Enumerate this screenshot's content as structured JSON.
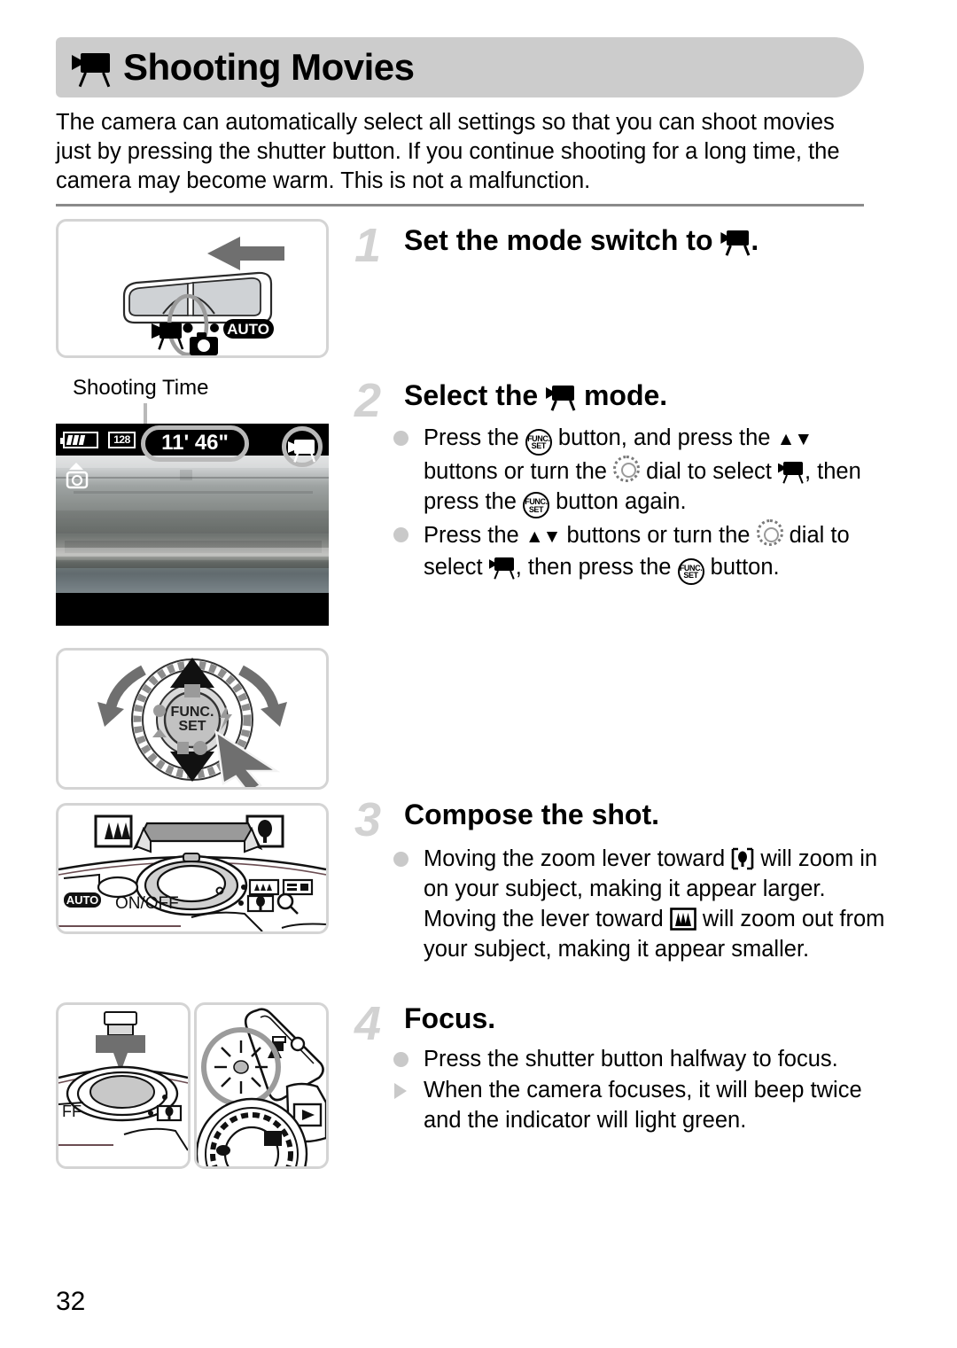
{
  "header": {
    "icon": "movie-camera-icon",
    "title": "Shooting Movies"
  },
  "intro": "The camera can automatically select all settings so that you can shoot movies just by pressing the shutter button. If you continue shooting for a long time, the camera may become warm. This is not a malfunction.",
  "steps": [
    {
      "number": "1",
      "heading_before": "Set the mode switch to ",
      "heading_icon": "movie-camera-icon",
      "heading_after": "."
    },
    {
      "number": "2",
      "heading_before": "Select the ",
      "heading_icon": "movie-camera-icon",
      "heading_after": " mode.",
      "bullets": [
        {
          "marker": "dot",
          "parts": [
            {
              "t": "text",
              "v": "Press the "
            },
            {
              "t": "icon",
              "v": "func-set-button-icon"
            },
            {
              "t": "text",
              "v": " button, and press the "
            },
            {
              "t": "icon",
              "v": "up-down-arrows-icon"
            },
            {
              "t": "text",
              "v": " buttons or turn the "
            },
            {
              "t": "icon",
              "v": "control-dial-icon"
            },
            {
              "t": "text",
              "v": " dial to select "
            },
            {
              "t": "icon",
              "v": "movie-camera-icon"
            },
            {
              "t": "text",
              "v": ", then press the "
            },
            {
              "t": "icon",
              "v": "func-set-button-icon"
            },
            {
              "t": "text",
              "v": " button again."
            }
          ]
        },
        {
          "marker": "dot",
          "parts": [
            {
              "t": "text",
              "v": "Press the "
            },
            {
              "t": "icon",
              "v": "up-down-arrows-icon"
            },
            {
              "t": "text",
              "v": " buttons or turn the "
            },
            {
              "t": "icon",
              "v": "control-dial-icon"
            },
            {
              "t": "text",
              "v": " dial to select "
            },
            {
              "t": "icon",
              "v": "movie-camera-icon"
            },
            {
              "t": "text",
              "v": ", then press the "
            },
            {
              "t": "icon",
              "v": "func-set-button-icon"
            },
            {
              "t": "text",
              "v": " button."
            }
          ]
        }
      ]
    },
    {
      "number": "3",
      "heading_before": "Compose the shot.",
      "heading_icon": "",
      "heading_after": "",
      "bullets": [
        {
          "marker": "dot",
          "parts": [
            {
              "t": "text",
              "v": "Moving the zoom lever toward "
            },
            {
              "t": "icon",
              "v": "telephoto-icon"
            },
            {
              "t": "text",
              "v": " will zoom in on your subject, making it appear larger. Moving the lever toward "
            },
            {
              "t": "icon",
              "v": "wide-angle-icon"
            },
            {
              "t": "text",
              "v": " will zoom out from your subject, making it appear smaller."
            }
          ]
        }
      ]
    },
    {
      "number": "4",
      "heading_before": "Focus.",
      "heading_icon": "",
      "heading_after": "",
      "bullets": [
        {
          "marker": "dot",
          "parts": [
            {
              "t": "text",
              "v": "Press the shutter button halfway to focus."
            }
          ]
        },
        {
          "marker": "triangle",
          "parts": [
            {
              "t": "text",
              "v": "When the camera focuses, it will beep twice and the indicator will light green."
            }
          ]
        }
      ]
    }
  ],
  "lcd": {
    "callout_label": "Shooting Time",
    "shooting_time": "11' 46\"",
    "card_label": "128",
    "battery_icon": "battery-icon",
    "stabilizer_icon": "image-stabilizer-icon",
    "mode_icon": "movie-mode-icon"
  },
  "illustrations": {
    "mode_switch": {
      "name": "mode-switch-illustration",
      "auto_label": "AUTO",
      "movie_icon": "movie-camera-icon",
      "photo_icon": "still-camera-icon",
      "arrow": "left-arrow"
    },
    "control_dial": {
      "name": "control-dial-illustration",
      "button_label_top": "FUNC.",
      "button_label_bottom": "SET"
    },
    "zoom_lever": {
      "name": "zoom-lever-illustration",
      "wide_icon": "wide-angle-icon",
      "tele_icon": "telephoto-icon",
      "power_label": "ON/OFF",
      "auto_label": "AUTO",
      "search_icon": "magnifier-icon"
    },
    "shutter": {
      "name": "shutter-button-illustration",
      "off_label": "FF",
      "tele_icon": "telephoto-icon"
    },
    "indicator": {
      "name": "indicator-lamp-illustration",
      "print_icon": "print-share-icon",
      "playback_icon": "playback-icon",
      "exposure_icon": "exposure-compensation-icon",
      "macro_icon": "macro-icon"
    }
  },
  "page_number": "32",
  "colors": {
    "banner_gray": "#cccccc",
    "step_number_gray": "#d2d2d2",
    "bullet_gray": "#c9c9c9",
    "frame_gray": "#d4d4d4",
    "rule_gray": "#8a8a8a"
  }
}
